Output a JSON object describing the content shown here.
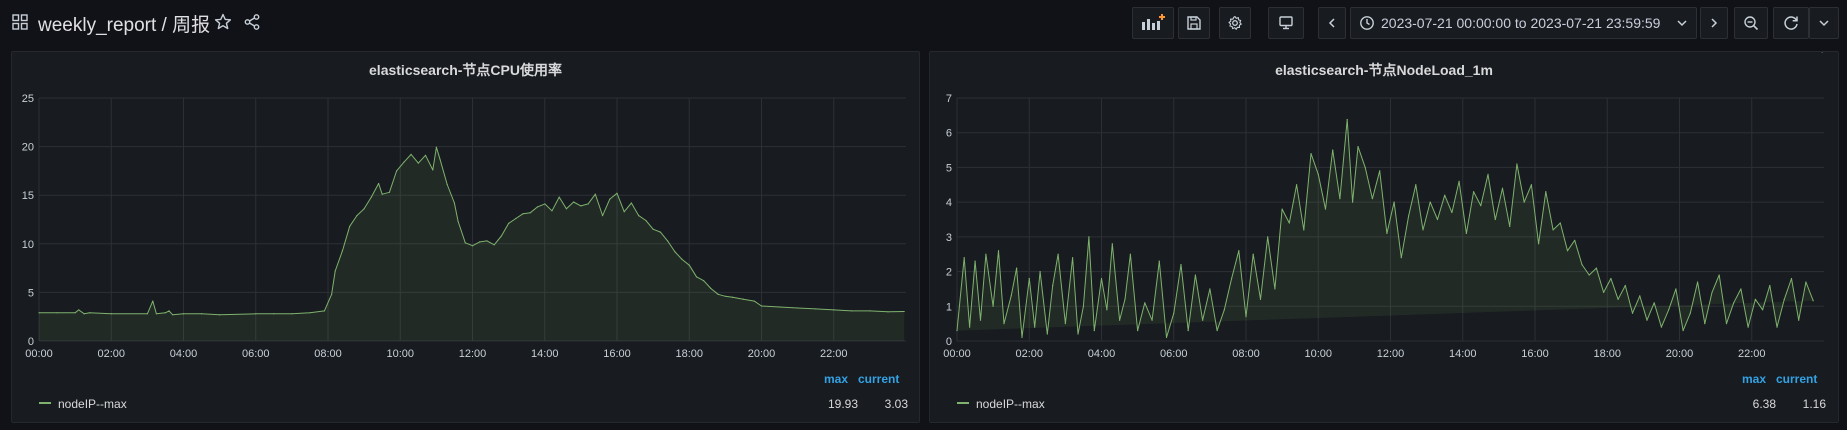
{
  "header": {
    "title": "weekly_report / 周报",
    "time_range": "2023-07-21 00:00:00 to 2023-07-21 23:59:59"
  },
  "icons": {
    "dashboards": "grid-icon",
    "star": "star-icon",
    "share": "share-icon",
    "add_panel": "add-panel-icon",
    "save": "save-icon",
    "settings": "gear-icon",
    "tv": "monitor-icon",
    "prev": "chevron-left-icon",
    "clock": "clock-icon",
    "next": "chevron-right-icon",
    "zoom_out": "zoom-out-icon",
    "refresh": "refresh-icon",
    "refresh_menu": "chevron-down-icon"
  },
  "colors": {
    "series": "#7eb26d",
    "legend_head": "#33a2e5",
    "accent": "#ff9830"
  },
  "panels": [
    {
      "title": "elasticsearch-节点CPU使用率",
      "legend": {
        "max_label": "max",
        "current_label": "current",
        "series_name": "nodeIP--max",
        "max": "19.93",
        "current": "3.03"
      },
      "chart_data": {
        "type": "area",
        "title": "elasticsearch-节点CPU使用率",
        "x_ticks": [
          "00:00",
          "02:00",
          "04:00",
          "06:00",
          "08:00",
          "10:00",
          "12:00",
          "14:00",
          "16:00",
          "18:00",
          "20:00",
          "22:00"
        ],
        "ylim": [
          0,
          25
        ],
        "y_ticks": [
          "0",
          "5",
          "10",
          "15",
          "20",
          "25"
        ],
        "grid": true,
        "legend_placement": "bottom",
        "series": [
          {
            "name": "nodeIP--max",
            "x": [
              0,
              0.5,
              1,
              1.1,
              1.25,
              1.4,
              2,
              3,
              3.15,
              3.25,
              3.5,
              3.6,
              3.7,
              4,
              4.5,
              5,
              6,
              6.5,
              7,
              7.5,
              7.9,
              8.1,
              8.2,
              8.4,
              8.6,
              8.8,
              9,
              9.2,
              9.4,
              9.5,
              9.7,
              9.9,
              10.1,
              10.3,
              10.5,
              10.7,
              10.9,
              11,
              11.1,
              11.3,
              11.5,
              11.6,
              11.8,
              12,
              12.2,
              12.4,
              12.6,
              12.8,
              13,
              13.2,
              13.4,
              13.6,
              13.8,
              14,
              14.2,
              14.4,
              14.6,
              14.8,
              15,
              15.2,
              15.4,
              15.6,
              15.8,
              16,
              16.2,
              16.4,
              16.6,
              16.8,
              17,
              17.2,
              17.4,
              17.6,
              17.8,
              18,
              18.2,
              18.4,
              18.6,
              18.8,
              19,
              19.2,
              19.5,
              19.8,
              20,
              20.5,
              21,
              21.5,
              22,
              22.5,
              23,
              23.5,
              23.95
            ],
            "y": [
              2.9,
              2.9,
              2.9,
              3.2,
              2.8,
              2.9,
              2.8,
              2.8,
              4.1,
              2.8,
              2.9,
              3.1,
              2.7,
              2.8,
              2.8,
              2.7,
              2.8,
              2.8,
              2.8,
              2.9,
              3.1,
              4.8,
              7.2,
              9.3,
              11.8,
              12.9,
              13.6,
              14.8,
              16.2,
              15.1,
              15.3,
              17.5,
              18.4,
              19.2,
              18.3,
              19.1,
              17.6,
              19.93,
              18.7,
              16.1,
              14.2,
              12.3,
              10.1,
              9.8,
              10.2,
              10.3,
              9.9,
              10.8,
              12.1,
              12.6,
              13.1,
              13.2,
              13.8,
              14.1,
              13.4,
              14.8,
              13.6,
              14.3,
              13.9,
              14.1,
              15.1,
              12.9,
              14.6,
              15.2,
              13.3,
              14.2,
              12.9,
              12.4,
              11.5,
              11.2,
              10.3,
              9.2,
              8.4,
              7.8,
              6.6,
              6.2,
              5.4,
              4.8,
              4.6,
              4.5,
              4.3,
              4.1,
              3.6,
              3.5,
              3.4,
              3.3,
              3.2,
              3.1,
              3.1,
              3.0,
              3.03
            ]
          }
        ]
      }
    },
    {
      "title": "elasticsearch-节点NodeLoad_1m",
      "legend": {
        "max_label": "max",
        "current_label": "current",
        "series_name": "nodeIP--max",
        "max": "6.38",
        "current": "1.16"
      },
      "chart_data": {
        "type": "area",
        "title": "elasticsearch-节点NodeLoad_1m",
        "x_ticks": [
          "00:00",
          "02:00",
          "04:00",
          "06:00",
          "08:00",
          "10:00",
          "12:00",
          "14:00",
          "16:00",
          "18:00",
          "20:00",
          "22:00"
        ],
        "ylim": [
          0,
          7
        ],
        "y_ticks": [
          "0",
          "1",
          "2",
          "3",
          "4",
          "5",
          "6",
          "7"
        ],
        "grid": true,
        "legend_placement": "bottom",
        "series": [
          {
            "name": "nodeIP--max",
            "x": [
              0,
              0.2,
              0.35,
              0.5,
              0.65,
              0.8,
              1,
              1.15,
              1.3,
              1.5,
              1.65,
              1.8,
              2,
              2.15,
              2.3,
              2.5,
              2.65,
              2.8,
              3,
              3.2,
              3.35,
              3.5,
              3.65,
              3.8,
              4,
              4.15,
              4.3,
              4.5,
              4.65,
              4.8,
              5,
              5.2,
              5.4,
              5.6,
              5.8,
              6,
              6.2,
              6.4,
              6.6,
              6.8,
              7,
              7.2,
              7.4,
              7.6,
              7.8,
              8,
              8.2,
              8.4,
              8.6,
              8.8,
              9,
              9.2,
              9.4,
              9.6,
              9.8,
              10,
              10.2,
              10.4,
              10.6,
              10.8,
              10.95,
              11.1,
              11.3,
              11.5,
              11.7,
              11.9,
              12.1,
              12.3,
              12.5,
              12.7,
              12.9,
              13.1,
              13.3,
              13.5,
              13.7,
              13.9,
              14.1,
              14.3,
              14.5,
              14.7,
              14.9,
              15.1,
              15.3,
              15.5,
              15.7,
              15.9,
              16.1,
              16.3,
              16.5,
              16.7,
              16.9,
              17.1,
              17.3,
              17.5,
              17.7,
              17.9,
              18.1,
              18.3,
              18.5,
              18.7,
              18.9,
              19.1,
              19.3,
              19.5,
              19.7,
              19.9,
              20.1,
              20.3,
              20.5,
              20.7,
              20.9,
              21.1,
              21.3,
              21.5,
              21.7,
              21.9,
              22.1,
              22.3,
              22.5,
              22.7,
              22.9,
              23.1,
              23.3,
              23.5,
              23.7,
              23.95
            ],
            "y": [
              0.3,
              2.4,
              0.4,
              2.3,
              0.6,
              2.5,
              1.0,
              2.6,
              0.5,
              1.3,
              2.1,
              0.1,
              1.8,
              0.4,
              2.0,
              0.2,
              1.6,
              2.5,
              0.5,
              2.4,
              0.2,
              1.0,
              3.0,
              0.3,
              1.8,
              0.9,
              2.8,
              0.6,
              1.2,
              2.5,
              0.3,
              1.1,
              0.6,
              2.3,
              0.1,
              0.8,
              2.2,
              0.3,
              1.9,
              0.6,
              1.5,
              0.3,
              0.9,
              1.8,
              2.6,
              0.7,
              2.5,
              1.2,
              3.0,
              1.5,
              3.8,
              3.4,
              4.5,
              3.2,
              5.4,
              4.8,
              3.8,
              5.5,
              4.1,
              6.38,
              4.0,
              5.6,
              5.0,
              4.1,
              4.9,
              3.1,
              4.0,
              2.4,
              3.6,
              4.5,
              3.2,
              4.0,
              3.5,
              4.2,
              3.7,
              4.6,
              3.1,
              4.3,
              3.9,
              4.8,
              3.5,
              4.4,
              3.3,
              5.1,
              4.0,
              4.5,
              2.8,
              4.3,
              3.2,
              3.4,
              2.6,
              2.9,
              2.2,
              1.9,
              2.1,
              1.4,
              1.8,
              1.2,
              1.6,
              0.8,
              1.3,
              0.6,
              1.1,
              0.4,
              0.9,
              1.5,
              0.3,
              0.8,
              1.7,
              0.5,
              1.4,
              1.9,
              0.5,
              1.1,
              1.5,
              0.4,
              1.2,
              0.9,
              1.6,
              0.4,
              1.2,
              1.8,
              0.6,
              1.7,
              1.16
            ]
          }
        ]
      }
    }
  ]
}
